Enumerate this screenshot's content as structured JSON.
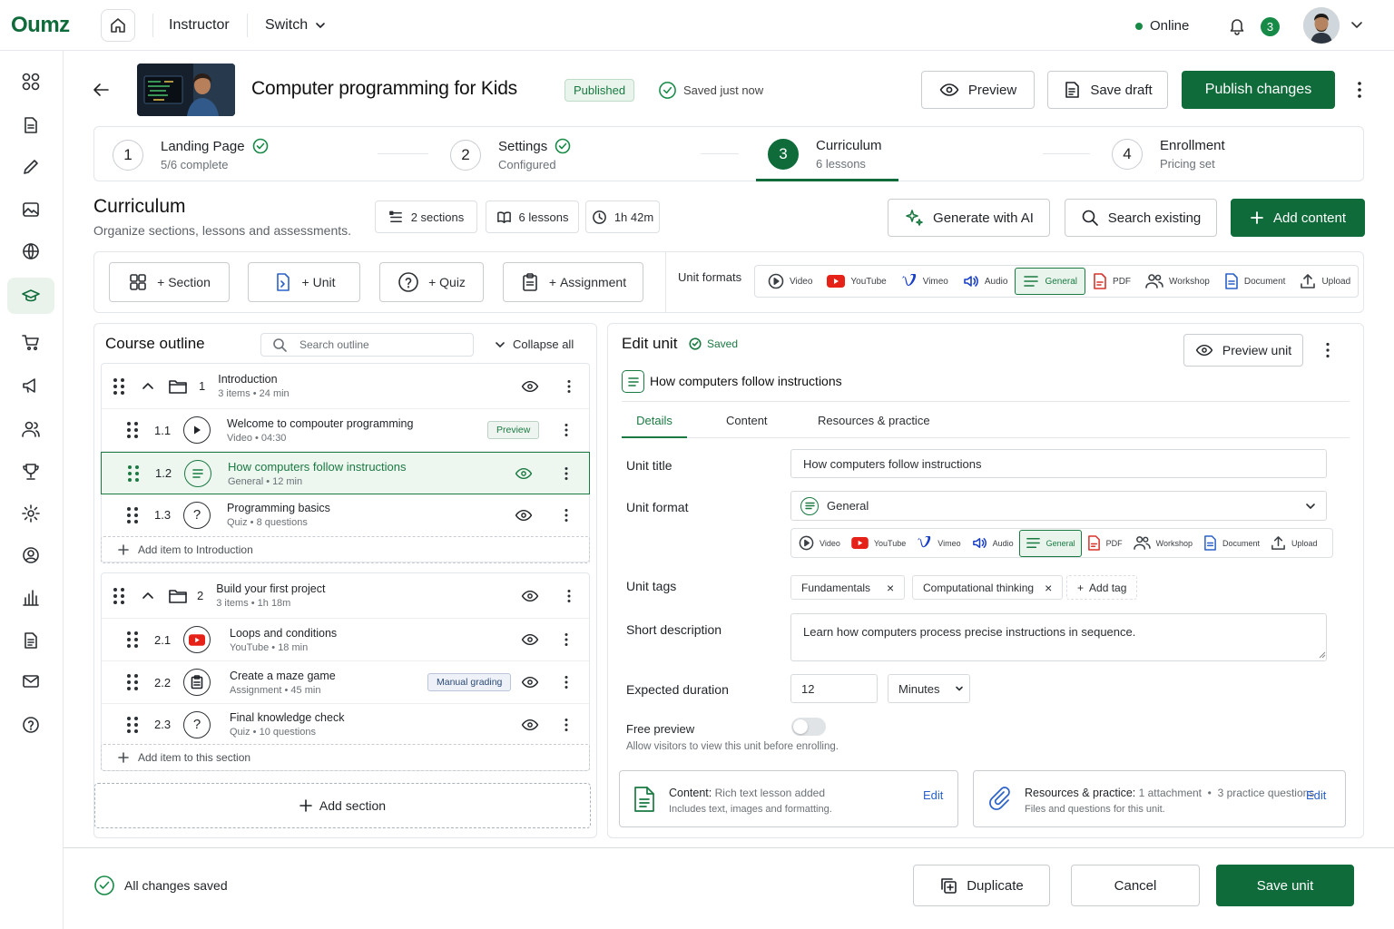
{
  "app": {
    "logo": "Oumz",
    "role": "Instructor",
    "switch_label": "Switch",
    "status": "Online",
    "notifications": "3"
  },
  "course": {
    "title": "Computer programming for Kids",
    "status": "Published",
    "saved_text": "Saved just now"
  },
  "header_buttons": {
    "preview": "Preview",
    "save_draft": "Save draft",
    "publish": "Publish changes"
  },
  "steps": [
    {
      "num": "1",
      "title": "Landing Page",
      "sub": "5/6 complete",
      "done": true
    },
    {
      "num": "2",
      "title": "Settings",
      "sub": "Configured",
      "done": true
    },
    {
      "num": "3",
      "title": "Curriculum",
      "sub": "6 lessons",
      "active": true
    },
    {
      "num": "4",
      "title": "Enrollment",
      "sub": "Pricing set"
    }
  ],
  "curriculum": {
    "title": "Curriculum",
    "subtitle": "Organize sections, lessons and assessments.",
    "stats": {
      "sections": "2 sections",
      "lessons": "6 lessons",
      "duration": "1h 42m"
    },
    "actions": {
      "generate": "Generate with AI",
      "search": "Search existing",
      "add": "Add content"
    }
  },
  "toolbar": {
    "section": "Section",
    "unit": "Unit",
    "quiz": "Quiz",
    "assignment": "Assignment",
    "unit_formats_label": "Unit formats",
    "formats": [
      "Video",
      "YouTube",
      "Vimeo",
      "Audio",
      "General",
      "PDF",
      "Workshop",
      "Document",
      "Upload"
    ],
    "selected_format": "General"
  },
  "outline": {
    "title": "Course outline",
    "search_placeholder": "Search outline",
    "collapse": "Collapse all",
    "sections": [
      {
        "num": "1",
        "title": "Introduction",
        "meta": "3 items • 24 min",
        "add_label": "Add item to Introduction",
        "items": [
          {
            "num": "1.1",
            "title": "Welcome to compouter programming",
            "meta": "Video • 04:30",
            "badge": "Preview"
          },
          {
            "num": "1.2",
            "title": "How computers follow instructions",
            "meta": "General • 12 min",
            "selected": true
          },
          {
            "num": "1.3",
            "title": "Programming basics",
            "meta": "Quiz • 8 questions"
          }
        ]
      },
      {
        "num": "2",
        "title": "Build your first project",
        "meta": "3 items • 1h 18m",
        "add_label": "Add item to this section",
        "items": [
          {
            "num": "2.1",
            "title": "Loops and conditions",
            "meta": "YouTube • 18 min"
          },
          {
            "num": "2.2",
            "title": "Create a maze game",
            "meta": "Assignment • 45 min",
            "badge": "Manual grading"
          },
          {
            "num": "2.3",
            "title": "Final knowledge check",
            "meta": "Quiz • 10 questions"
          }
        ]
      }
    ],
    "add_section": "Add section"
  },
  "edit": {
    "title": "Edit unit",
    "saved": "Saved",
    "preview_unit": "Preview unit",
    "unit_heading": "How computers follow instructions",
    "tabs": [
      "Details",
      "Content",
      "Resources & practice"
    ],
    "labels": {
      "unit_title": "Unit title",
      "unit_format": "Unit format",
      "unit_tags": "Unit tags",
      "short_desc": "Short description",
      "duration": "Expected duration",
      "free_preview": "Free preview"
    },
    "unit_title_value": "How computers follow instructions",
    "unit_format_value": "General",
    "tags": [
      "Fundamentals",
      "Computational thinking"
    ],
    "add_tag": "Add tag",
    "description": "Learn how computers process precise instructions in sequence.",
    "duration_value": "12",
    "duration_unit": "Minutes",
    "free_preview_hint": "Allow visitors to view this unit before enrolling.",
    "free_preview_on": false,
    "content_card": {
      "label": "Content:",
      "value": "Rich text lesson added",
      "sub": "Includes text, images and formatting.",
      "action": "Edit"
    },
    "resources_card": {
      "label": "Resources & practice:",
      "value1": "1 attachment",
      "value2": "3 practice questions",
      "sub": "Files and questions for this unit.",
      "action": "Edit"
    }
  },
  "footer": {
    "status": "All changes saved",
    "duplicate": "Duplicate",
    "cancel": "Cancel",
    "save": "Save unit"
  },
  "colors": {
    "brand": "#0f6b3a",
    "youtube": "#e62117",
    "vimeo": "#1a3fc7",
    "pdf": "#d8332a"
  }
}
